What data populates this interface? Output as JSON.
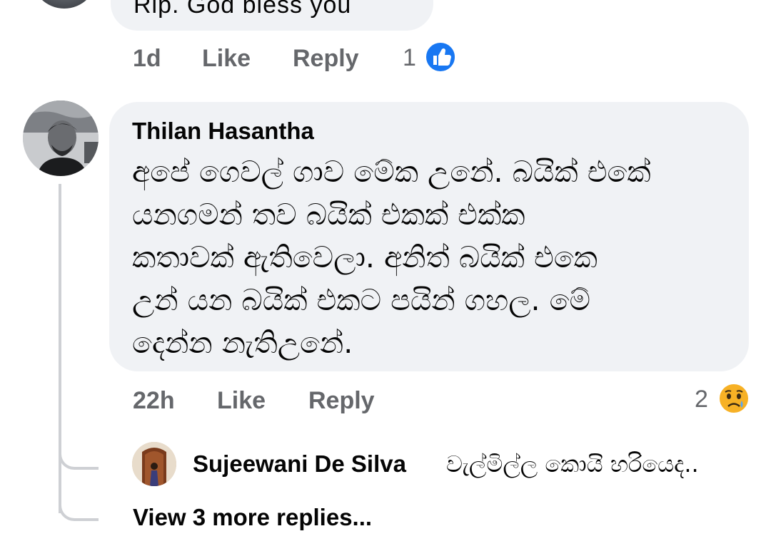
{
  "previous_comment": {
    "text": "Rip. God bless you",
    "time": "1d",
    "like_label": "Like",
    "reply_label": "Reply",
    "reaction_count": "1",
    "reaction_icon": "like-thumb-icon"
  },
  "comment": {
    "author": "Thilan Hasantha",
    "lines": [
      "අපේ ගෙවල් ගාව මේක උනේ. බයික් එකේ",
      "යනගමන් තව බයික් එකක් එක්ක",
      "කතාවක් ඇතිවෙලා. අනිත් බයික් එකෙ",
      "උන් යන බයික් එකට පයින් ගහල. මේ",
      "දෙන්න නැතිඋනේ."
    ],
    "time": "22h",
    "like_label": "Like",
    "reply_label": "Reply",
    "reaction_count": "2",
    "reaction_icon": "sad-face-icon"
  },
  "reply_preview": {
    "author": "Sujeewani De Silva",
    "text": "වැල්මිල්ල කොයි හරියෙද.."
  },
  "view_more_label": "View 3 more replies...",
  "colors": {
    "bubble": "#f0f2f5",
    "meta_text": "#65676b",
    "like_blue": "#1877f2",
    "sad_yellow": "#f7b125",
    "thread_line": "#ced0d4"
  }
}
